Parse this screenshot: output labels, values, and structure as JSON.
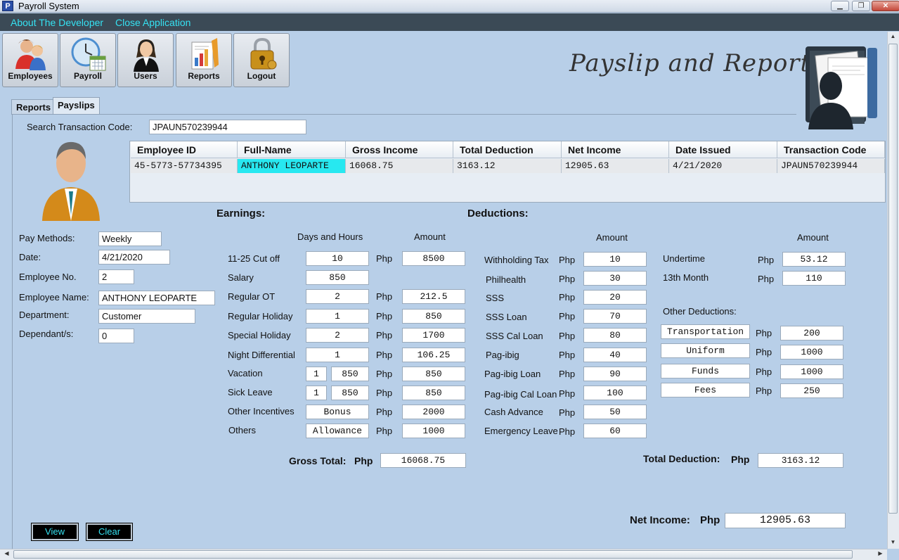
{
  "window": {
    "title": "Payroll System",
    "icon": "P",
    "min": "▁",
    "max": "❐",
    "close": "✕"
  },
  "menu": {
    "about": "About The Developer",
    "close": "Close Application"
  },
  "toolbar": [
    {
      "label": "Employees",
      "icon": "employees-icon"
    },
    {
      "label": "Payroll",
      "icon": "clock-calendar-icon"
    },
    {
      "label": "Users",
      "icon": "user-headset-icon"
    },
    {
      "label": "Reports",
      "icon": "reports-icon"
    },
    {
      "label": "Logout",
      "icon": "padlock-icon"
    }
  ],
  "banner": {
    "title": "Payslip and Reports"
  },
  "tabs": {
    "reports": "Reports",
    "payslips": "Payslips"
  },
  "search": {
    "label": "Search Transaction Code:",
    "value": "JPAUN570239944"
  },
  "grid": {
    "headers": [
      "Employee ID",
      "Full-Name",
      "Gross Income",
      "Total Deduction",
      "Net Income",
      "Date Issued",
      "Transaction Code"
    ],
    "rows": [
      [
        "45-5773-57734395",
        "ANTHONY LEOPARTE",
        "16068.75",
        "3163.12",
        "12905.63",
        "4/21/2020",
        "JPAUN570239944"
      ]
    ]
  },
  "employee": {
    "pay_methods_label": "Pay Methods:",
    "pay_methods": "Weekly",
    "date_label": "Date:",
    "date": "4/21/2020",
    "no_label": "Employee No.",
    "no": "2",
    "name_label": "Employee Name:",
    "name": "ANTHONY LEOPARTE",
    "dept_label": "Department:",
    "dept": "Customer",
    "dep_label": "Dependant/s:",
    "dep": "0"
  },
  "earnings": {
    "title": "Earnings:",
    "days_hours": "Days and Hours",
    "amount": "Amount",
    "php": "Php",
    "cutoff_label": "11-25 Cut off",
    "cutoff_days": "10",
    "cutoff_amt": "8500",
    "salary_label": "Salary",
    "salary": "850",
    "reg_ot_label": "Regular OT",
    "reg_ot_hrs": "2",
    "reg_ot_amt": "212.5",
    "reg_hol_label": "Regular Holiday",
    "reg_hol_days": "1",
    "reg_hol_amt": "850",
    "spec_hol_label": "Special Holiday",
    "spec_hol_days": "2",
    "spec_hol_amt": "1700",
    "night_label": "Night Differential",
    "night_hrs": "1",
    "night_amt": "106.25",
    "vac_label": "Vacation",
    "vac_days": "1",
    "vac_rate": "850",
    "vac_amt": "850",
    "sick_label": "Sick Leave",
    "sick_days": "1",
    "sick_rate": "850",
    "sick_amt": "850",
    "other_inc_label": "Other Incentives",
    "other_inc_name": "Bonus",
    "other_inc_amt": "2000",
    "others_label": "Others",
    "others_name": "Allowance",
    "others_amt": "1000",
    "gross_label": "Gross Total:",
    "gross": "16068.75"
  },
  "deductions": {
    "title": "Deductions:",
    "amount": "Amount",
    "php": "Php",
    "tax_label": "Withholding Tax",
    "tax": "10",
    "phil_label": "Philhealth",
    "phil": "30",
    "sss_label": "SSS",
    "sss": "20",
    "sss_loan_label": "SSS Loan",
    "sss_loan": "70",
    "sss_cal_label": "SSS Cal Loan",
    "sss_cal": "80",
    "pagibig_label": "Pag-ibig",
    "pagibig": "40",
    "pagibig_loan_label": "Pag-ibig Loan",
    "pagibig_loan": "90",
    "pagibig_cal_label": "Pag-ibig Cal Loan",
    "pagibig_cal": "100",
    "cash_label": "Cash Advance",
    "cash": "50",
    "emerg_label": "Emergency Leave",
    "emerg": "60",
    "amount2": "Amount",
    "under_label": "Undertime",
    "under": "53.12",
    "month13_label": "13th Month",
    "month13": "110",
    "other_ded_label": "Other Deductions:",
    "transport_name": "Transportation",
    "transport": "200",
    "uniform_name": "Uniform",
    "uniform": "1000",
    "funds_name": "Funds",
    "funds": "1000",
    "fees_name": "Fees",
    "fees": "250",
    "total_label": "Total Deduction:",
    "total": "3163.12"
  },
  "net": {
    "label": "Net Income:",
    "php": "Php",
    "value": "12905.63"
  },
  "buttons": {
    "view": "View",
    "clear": "Clear"
  }
}
